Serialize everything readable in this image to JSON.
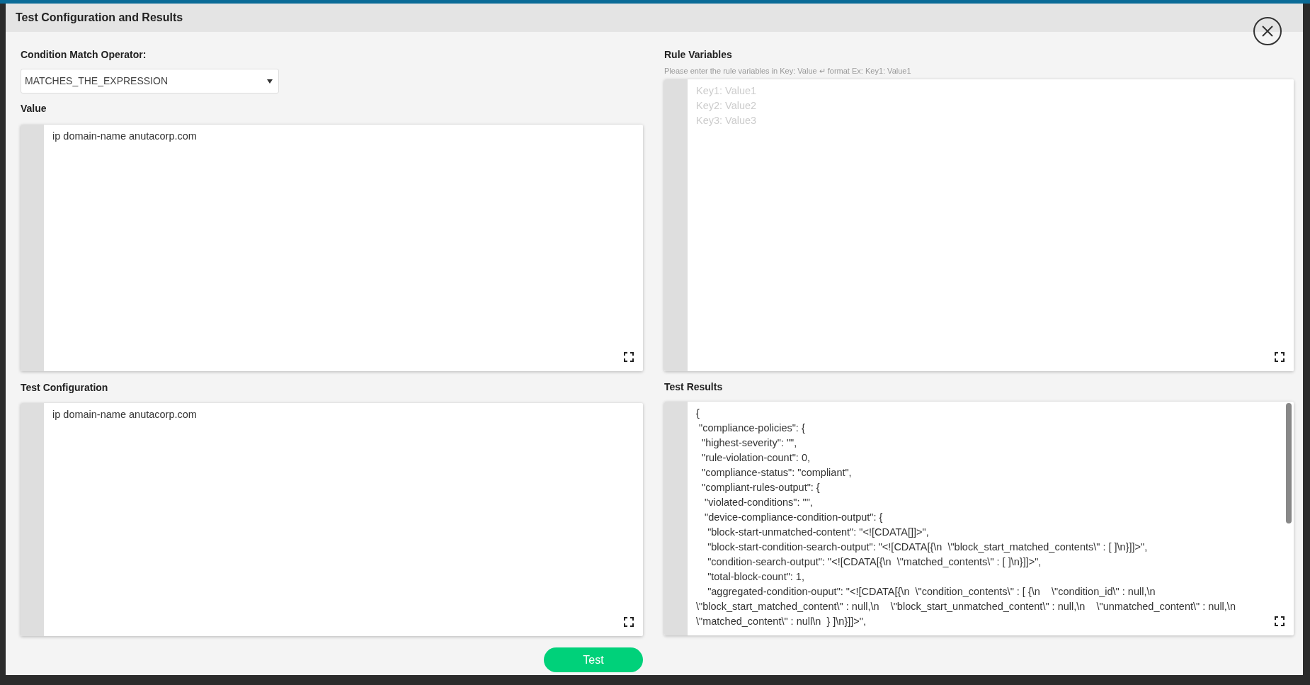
{
  "dialog": {
    "title": "Test Configuration and Results"
  },
  "operator": {
    "label": "Condition Match Operator:",
    "value": "MATCHES_THE_EXPRESSION"
  },
  "value_editor": {
    "label": "Value",
    "lines": [
      "ip domain-name anutacorp.com"
    ]
  },
  "test_configuration": {
    "label": "Test Configuration",
    "lines": [
      "ip domain-name anutacorp.com"
    ]
  },
  "rule_variables": {
    "label": "Rule Variables",
    "hint": "Please enter the rule variables in Key: Value ↵ format Ex: Key1: Value1",
    "placeholder": "Key1: Value1\nKey2: Value2\nKey3: Value3"
  },
  "test_results": {
    "label": "Test Results",
    "lines": [
      "{",
      " \"compliance-policies\": {",
      "  \"highest-severity\": \"\",",
      "  \"rule-violation-count\": 0,",
      "  \"compliance-status\": \"compliant\",",
      "  \"compliant-rules-output\": {",
      "   \"violated-conditions\": \"\",",
      "   \"device-compliance-condition-output\": {",
      "    \"block-start-unmatched-content\": \"<![CDATA[]]>\",",
      "    \"block-start-condition-search-output\": \"<![CDATA[{\\n  \\\"block_start_matched_contents\\\" : [ ]\\n}]]>\",",
      "    \"condition-search-output\": \"<![CDATA[{\\n  \\\"matched_contents\\\" : [ ]\\n}]]>\",",
      "    \"total-block-count\": 1,",
      "    \"aggregated-condition-ouput\": \"<![CDATA[{\\n  \\\"condition_contents\\\" : [ {\\n    \\\"condition_id\\\" : null,\\n    \\\"block_start_matched_content\\\" : null,\\n    \\\"block_start_unmatched_content\\\" : null,\\n    \\\"unmatched_content\\\" : null,\\n    \\\"matched_content\\\" : null\\n  } ]\\n}]]>\","
    ]
  },
  "test_button": "Test"
}
